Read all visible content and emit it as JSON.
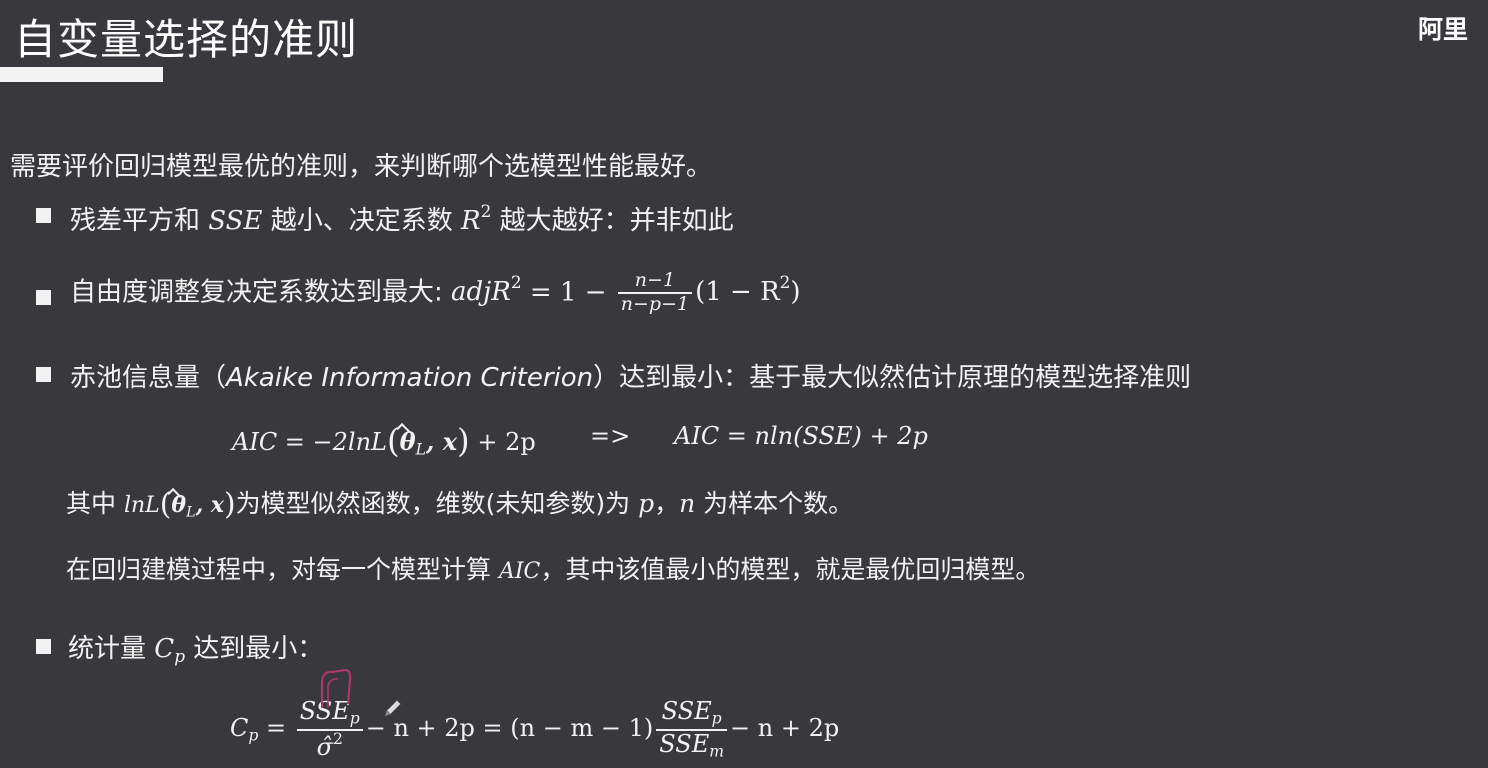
{
  "header": {
    "title": "自变量选择的准则",
    "corner_text": "阿里"
  },
  "intro": "需要评价回归模型最优的准则，来判断哪个选模型性能最好。",
  "b1": {
    "t1": "残差平方和",
    "sse": "SSE",
    "t2": "越小、决定系数",
    "R": "R",
    "sq": "2",
    "t3": "越大越好：并非如此"
  },
  "b2": {
    "text": "自由度调整复决定系数达到最大:",
    "lhs": "adjR",
    "sq": "2",
    "eq": "= 1 −",
    "num": "n−1",
    "den": "n−p−1",
    "rhs_open": "(1 − R",
    "rhs_sq": "2",
    "rhs_close": ")"
  },
  "b3": {
    "t1": "赤池信息量（",
    "aic_en": "Akaike Information Criterion",
    "t2": "）达到最小：基于最大似然估计原理的模型选择准则",
    "f1_lhs": "AIC = −2lnL",
    "theta": "θ",
    "sub_L": "L",
    "x": ", x",
    "f1_rhs": "+ 2p",
    "arrow": "=>",
    "f2": "AIC = nln(SSE) + 2p",
    "line1_a": "其中",
    "line1_m": "lnL",
    "line1_b": "为模型似然函数，维数(未知参数)为",
    "p": "p",
    "comma": "，",
    "n": "n",
    "line1_c": "为样本个数。",
    "line2_a": "在回归建模过程中，对每一个模型计算",
    "aic": "AIC",
    "line2_b": "，其中该值最小的模型，就是最优回归模型。"
  },
  "b4": {
    "t1": "统计量",
    "C": "C",
    "sub_p": "p",
    "t2": "达到最小：",
    "lhs": "C",
    "lhs_sub": "p",
    "eq": "=",
    "num1": "SSE",
    "num1_sub": "p",
    "den1": "σ̂",
    "den1_sq": "2",
    "mid": "− n + 2p = (n − m − 1)",
    "num2": "SSE",
    "num2_sub": "p",
    "den2": "SSE",
    "den2_sub": "m",
    "tail": "− n + 2p"
  },
  "colors": {
    "background": "#39393d",
    "text": "#f2f2f2",
    "annotation": "#b0386a"
  },
  "icons": [
    "bullet-square-icon",
    "pencil-cursor-icon"
  ]
}
